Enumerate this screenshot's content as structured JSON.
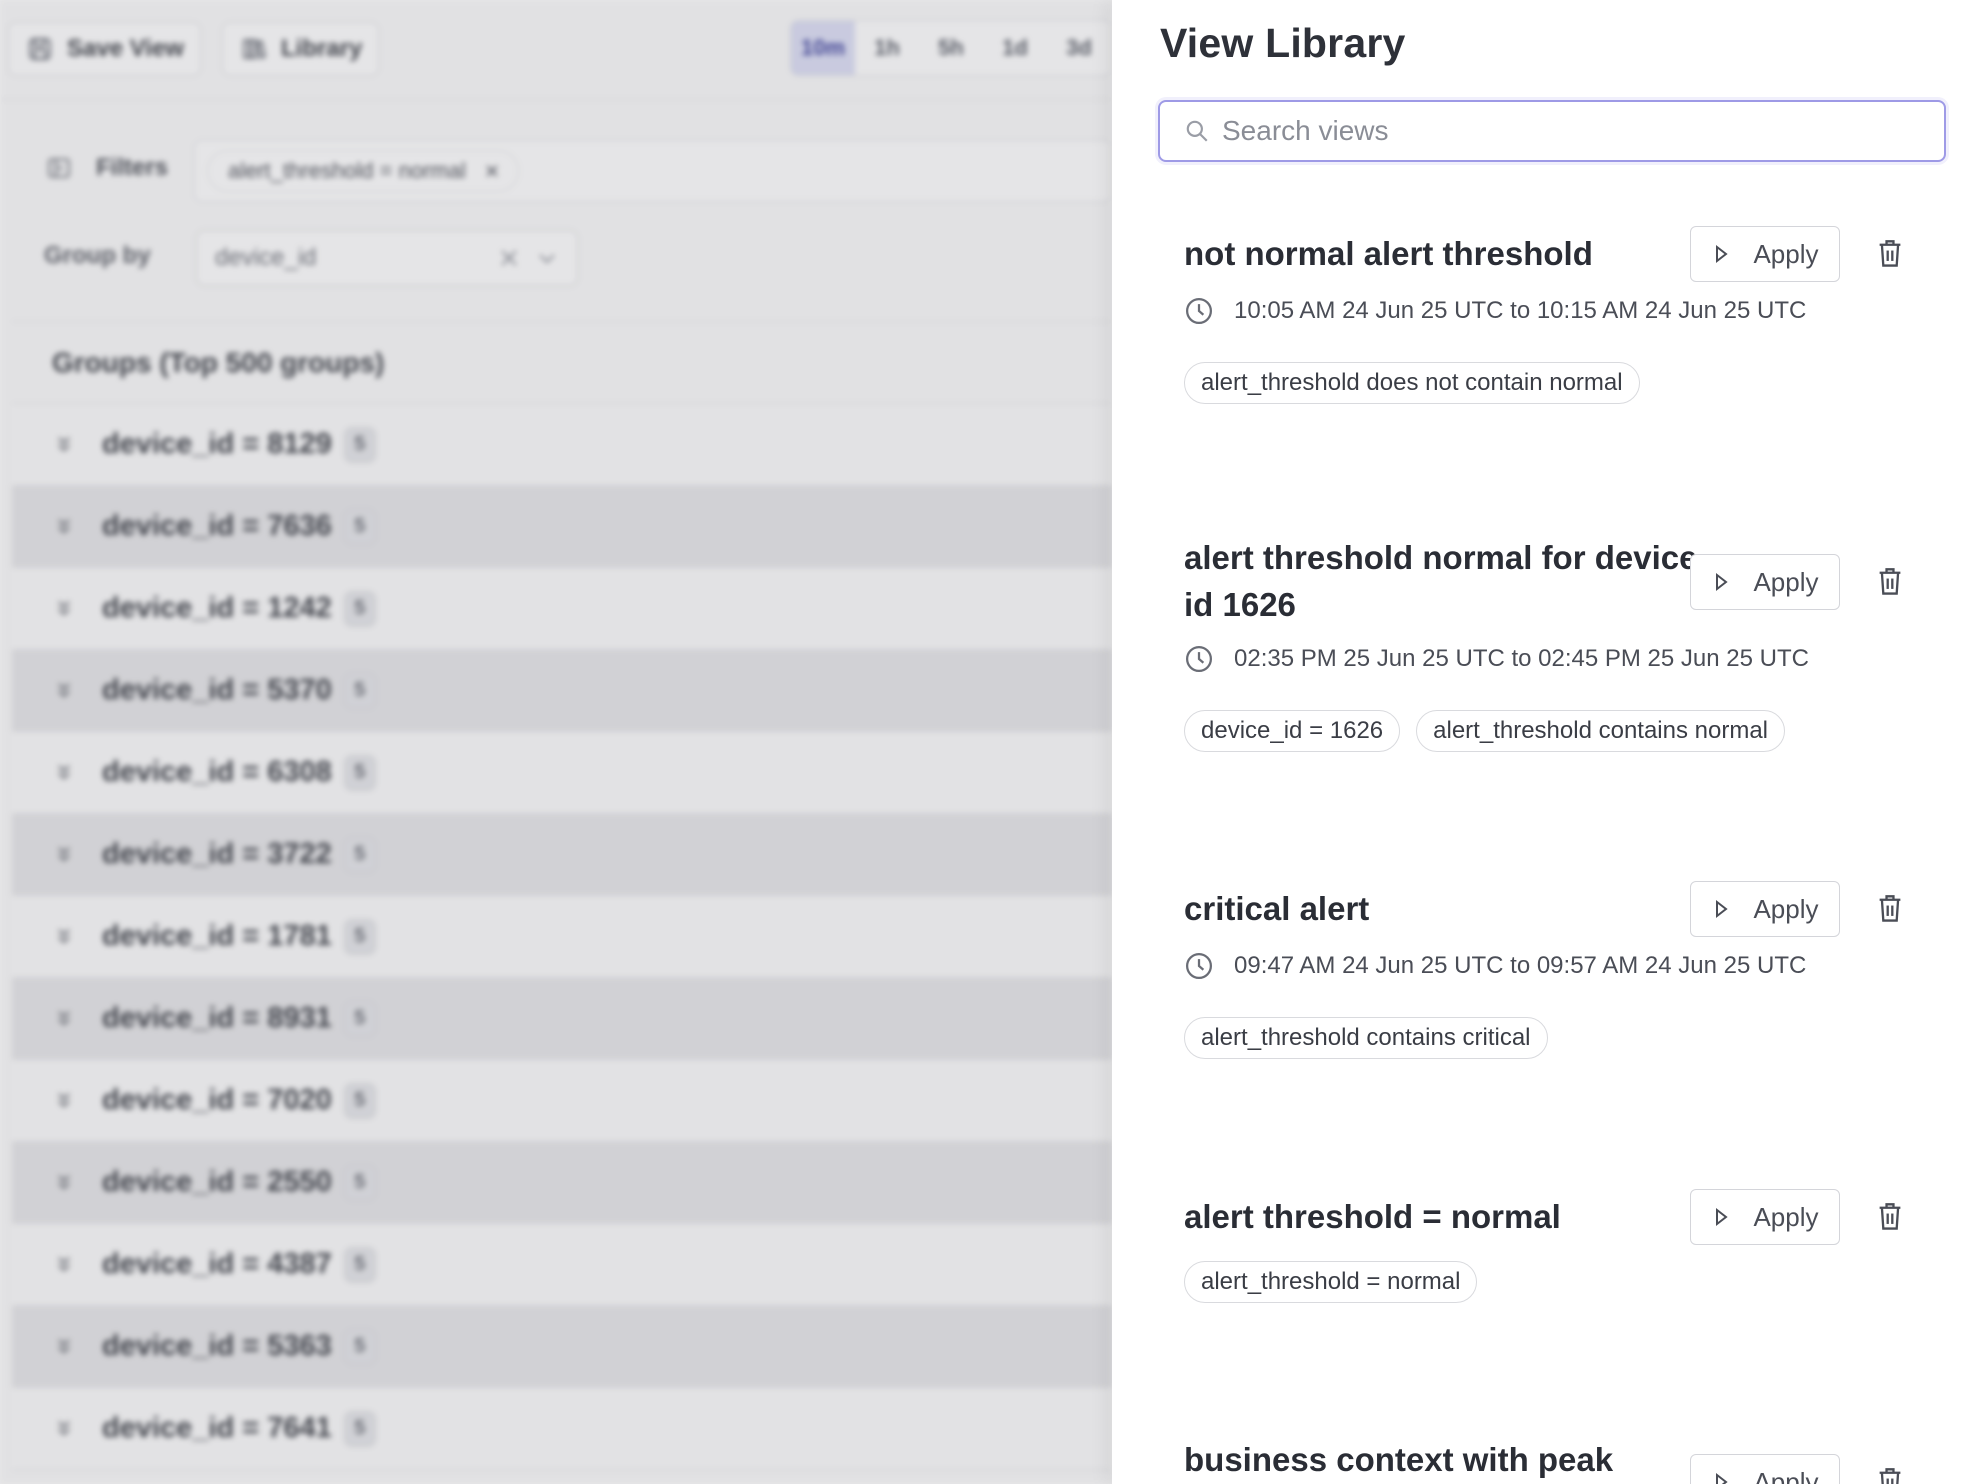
{
  "toolbar": {
    "save_view_label": "Save View",
    "library_label": "Library",
    "time_ranges": [
      "10m",
      "1h",
      "5h",
      "1d",
      "3d"
    ],
    "active_time_range": "10m"
  },
  "filters": {
    "label": "Filters",
    "chip_text": "alert_threshold = normal",
    "group_by_label": "Group by",
    "group_by_value": "device_id"
  },
  "groups": {
    "header": "Groups (Top 500 groups)",
    "rows": [
      {
        "label": "device_id = 8129",
        "count": "5"
      },
      {
        "label": "device_id = 7636",
        "count": "5"
      },
      {
        "label": "device_id = 1242",
        "count": "5"
      },
      {
        "label": "device_id = 5370",
        "count": "5"
      },
      {
        "label": "device_id = 6308",
        "count": "5"
      },
      {
        "label": "device_id = 3722",
        "count": "5"
      },
      {
        "label": "device_id = 1781",
        "count": "5"
      },
      {
        "label": "device_id = 8931",
        "count": "5"
      },
      {
        "label": "device_id = 7020",
        "count": "5"
      },
      {
        "label": "device_id = 2550",
        "count": "5"
      },
      {
        "label": "device_id = 4387",
        "count": "5"
      },
      {
        "label": "device_id = 5363",
        "count": "5"
      },
      {
        "label": "device_id = 7641",
        "count": "5"
      }
    ]
  },
  "library": {
    "title": "View Library",
    "search_placeholder": "Search views",
    "search_value": "",
    "apply_label": "Apply",
    "views": [
      {
        "name": "not normal alert threshold",
        "time_range": "10:05 AM 24 Jun 25 UTC to 10:15 AM 24 Jun 25 UTC",
        "filters": [
          "alert_threshold does not contain normal"
        ]
      },
      {
        "name": "alert threshold normal for device id 1626",
        "time_range": "02:35 PM 25 Jun 25 UTC to 02:45 PM 25 Jun 25 UTC",
        "filters": [
          "device_id = 1626",
          "alert_threshold contains normal"
        ]
      },
      {
        "name": "critical alert",
        "time_range": "09:47 AM 24 Jun 25 UTC to 09:57 AM 24 Jun 25 UTC",
        "filters": [
          "alert_threshold contains critical"
        ]
      },
      {
        "name": "alert threshold = normal",
        "time_range": "",
        "filters": [
          "alert_threshold = normal"
        ]
      },
      {
        "name": "business context with peak",
        "time_range": "",
        "filters": []
      }
    ]
  },
  "colors": {
    "accent": "#9e9ae6",
    "active_time_bg": "#d9dbf2"
  }
}
